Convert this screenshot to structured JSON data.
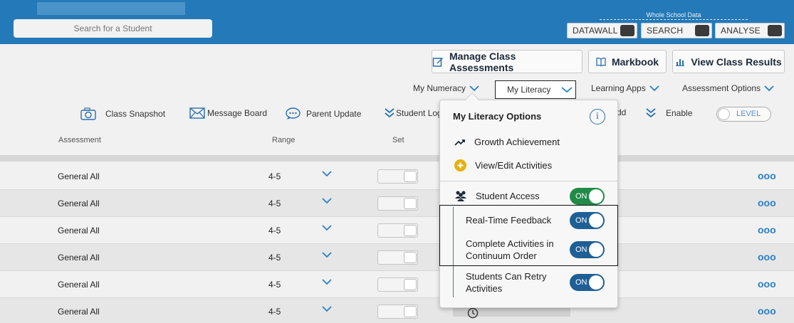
{
  "header": {
    "search_placeholder": "Search for a Student",
    "whole_school_label": "Whole School Data",
    "whole_school_buttons": [
      "DATAWALL",
      "SEARCH",
      "ANALYSE"
    ]
  },
  "toolbar": {
    "manage": "Manage Class Assessments",
    "markbook": "Markbook",
    "results": "View Class Results"
  },
  "dropdowns": [
    "My Numeracy",
    "My Literacy",
    "Learning Apps",
    "Assessment Options"
  ],
  "tools": {
    "snapshot": "Class Snapshot",
    "message": "Message Board",
    "parent": "Parent Update",
    "student_log": "Student Log",
    "add": "dd",
    "enable": "Enable",
    "level": "LEVEL"
  },
  "table": {
    "headers": {
      "assessment": "Assessment",
      "range": "Range",
      "set": "Set"
    },
    "rows": [
      {
        "assessment": "General All",
        "range": "4-5"
      },
      {
        "assessment": "General All",
        "range": "4-5"
      },
      {
        "assessment": "General All",
        "range": "4-5"
      },
      {
        "assessment": "General All",
        "range": "4-5"
      },
      {
        "assessment": "General All",
        "range": "4-5"
      },
      {
        "assessment": "General All",
        "range": "4-5"
      }
    ],
    "more_glyph": "ooo"
  },
  "popup": {
    "title": "My Literacy Options",
    "info": "i",
    "growth": "Growth Achievement",
    "view_edit": "View/Edit Activities",
    "student_access": "Student Access",
    "realtime": "Real-Time Feedback",
    "complete_line1": "Complete Activities in",
    "complete_line2": "Continuum Order",
    "retry_line1": "Students Can Retry",
    "retry_line2": "Activities",
    "on": "ON"
  },
  "colors": {
    "header_blue": "#2479b8",
    "accent": "#2a7fc9",
    "toggle_green": "#1f8b46",
    "toggle_blue": "#1e5f96"
  }
}
